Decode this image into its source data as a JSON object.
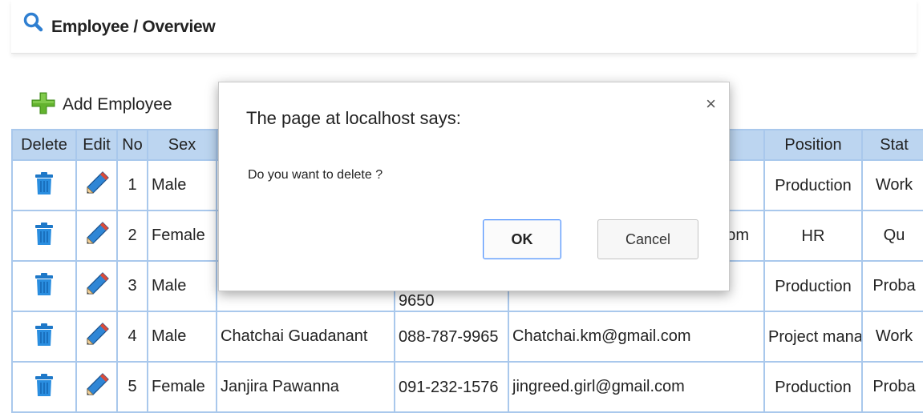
{
  "header": {
    "title": "Employee / Overview"
  },
  "toolbar": {
    "add_label": "Add Employee"
  },
  "table": {
    "columns": [
      "Delete",
      "Edit",
      "No",
      "Sex",
      "",
      "",
      "",
      "Position",
      "Stat"
    ],
    "rows": [
      {
        "no": "1",
        "sex": "Male",
        "name": "",
        "phone": "",
        "email": "",
        "position": "Production",
        "status": "Work"
      },
      {
        "no": "2",
        "sex": "Female",
        "name": "",
        "phone": "",
        "email": "om",
        "position": "HR",
        "status": "Qu"
      },
      {
        "no": "3",
        "sex": "Male",
        "name": "",
        "phone": "9650",
        "email": "",
        "position": "Production",
        "status": "Proba"
      },
      {
        "no": "4",
        "sex": "Male",
        "name": "Chatchai Guadanant",
        "phone": "088-787-9965",
        "email": "Chatchai.km@gmail.com",
        "position": "Project manager",
        "status": "Work"
      },
      {
        "no": "5",
        "sex": "Female",
        "name": "Janjira Pawanna",
        "phone": "091-232-1576",
        "email": "jingreed.girl@gmail.com",
        "position": "Production",
        "status": "Proba"
      }
    ]
  },
  "dialog": {
    "title": "The page at localhost says:",
    "message": "Do you want to delete ?",
    "ok_label": "OK",
    "cancel_label": "Cancel",
    "close_symbol": "×"
  }
}
